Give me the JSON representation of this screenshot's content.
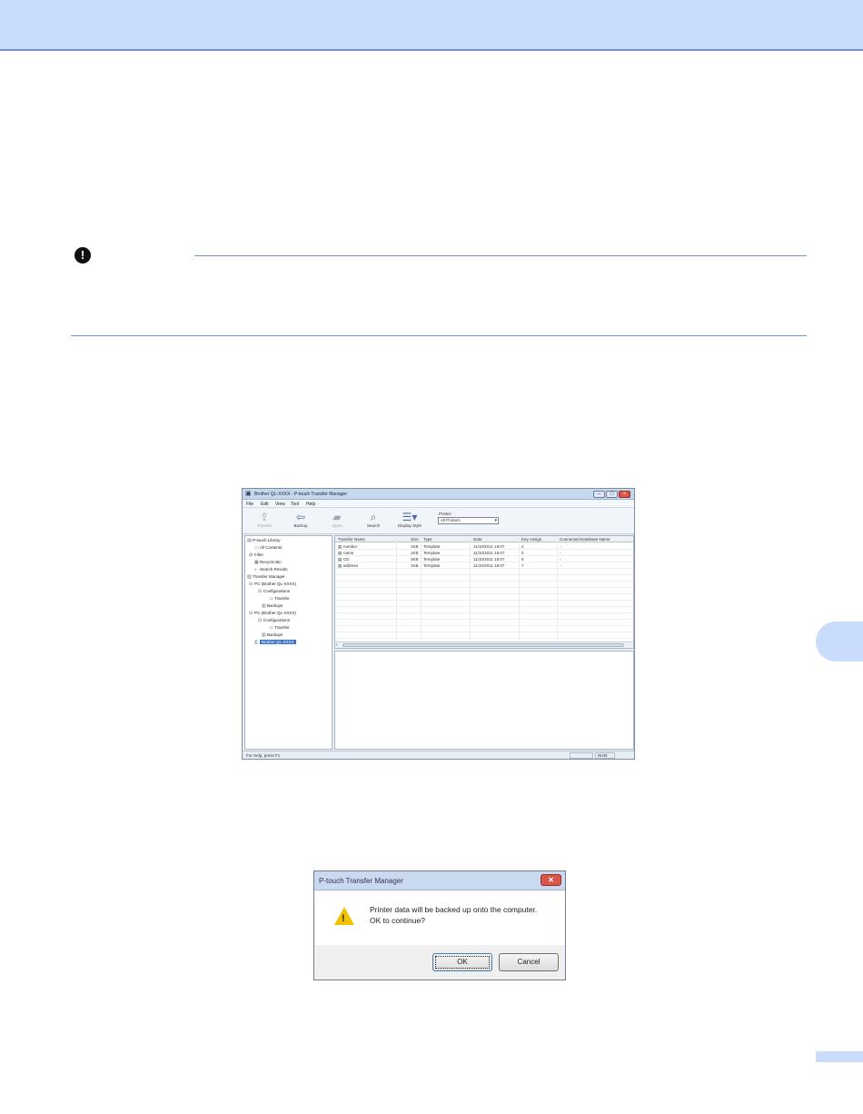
{
  "app_window": {
    "title": "Brother QL-XXXX - P-touch Transfer Manager",
    "menu": [
      "File",
      "Edit",
      "View",
      "Tool",
      "Help"
    ],
    "toolbar": [
      {
        "label": "Transfer",
        "icon": "transfer-icon",
        "enabled": false
      },
      {
        "label": "Backup",
        "icon": "backup-icon",
        "enabled": true
      },
      {
        "label": "Open",
        "icon": "open-folder-icon",
        "enabled": false
      },
      {
        "label": "Search",
        "icon": "search-icon",
        "enabled": true
      },
      {
        "label": "Display Style",
        "icon": "display-style-icon",
        "enabled": true
      }
    ],
    "printer_label": "Printer:",
    "printer_value": "All Printers",
    "tree": [
      {
        "label": "P-touch Library",
        "icon": "library-icon",
        "level": 0
      },
      {
        "label": "All Contents",
        "icon": "folder-icon",
        "level": 1
      },
      {
        "label": "Filter",
        "icon": "filter-icon",
        "level": 1
      },
      {
        "label": "Recycle Bin",
        "icon": "recycle-bin-icon",
        "level": 1
      },
      {
        "label": "Search Results",
        "icon": "search-icon",
        "level": 1
      },
      {
        "label": "Transfer Manager",
        "icon": "transfer-manager-icon",
        "level": 0
      },
      {
        "label": "PC (Brother QL-XXXX)",
        "icon": "computer-icon",
        "level": 1
      },
      {
        "label": "Configurations",
        "icon": "configurations-icon",
        "level": 2
      },
      {
        "label": "Transfer",
        "icon": "folder-icon",
        "level": 3
      },
      {
        "label": "Backups",
        "icon": "backups-icon",
        "level": 2
      },
      {
        "label": "PC (Brother QL-XXXX)",
        "icon": "computer-icon",
        "level": 1
      },
      {
        "label": "Configurations",
        "icon": "configurations-icon",
        "level": 2
      },
      {
        "label": "Transfer",
        "icon": "folder-icon",
        "level": 3
      },
      {
        "label": "Backups",
        "icon": "backups-icon",
        "level": 2
      },
      {
        "label": "Brother QL-XXXX",
        "icon": "printer-icon",
        "level": 1,
        "selected": true
      }
    ],
    "columns": [
      "Transfer Name",
      "Size",
      "Type",
      "Date",
      "Key Assign",
      "Connected Database Name"
    ],
    "rows": [
      [
        "number",
        "1KB",
        "Template",
        "11/10/2011 18:07",
        "2",
        "-"
      ],
      [
        "name",
        "1KB",
        "Template",
        "11/10/2011 18:07",
        "3",
        "-"
      ],
      [
        "CD",
        "3KB",
        "Template",
        "11/10/2011 18:07",
        "6",
        "-"
      ],
      [
        "address",
        "1KB",
        "Template",
        "11/10/2011 18:07",
        "7",
        "-"
      ]
    ],
    "status_text": "For Help, press F1",
    "status_cells": [
      "",
      "NUM"
    ]
  },
  "dialog": {
    "title": "P-touch Transfer Manager",
    "message_line1": "Printer data will be backed up onto the computer.",
    "message_line2": "OK to continue?",
    "ok_label": "OK",
    "cancel_label": "Cancel"
  },
  "colors": {
    "band": "#c9dcfb",
    "rule": "#6f93c9",
    "selection": "#3b73c7",
    "warning": "#f2c200"
  }
}
